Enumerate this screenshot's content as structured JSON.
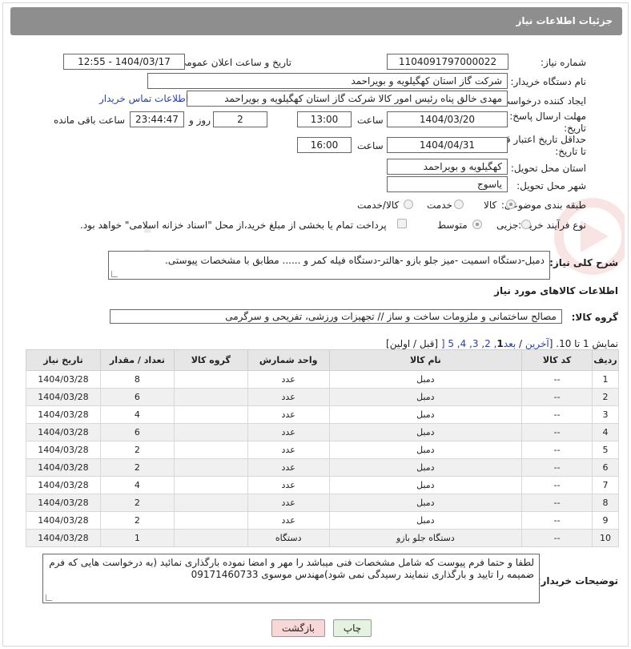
{
  "header": {
    "title": "جزئیات اطلاعات نیاز"
  },
  "form": {
    "need_number_label": "شماره نیاز:",
    "need_number": "1104091797000022",
    "announce_label": "تاریخ و ساعت اعلان عمومی:",
    "announce_value": "1404/03/17 - 12:55",
    "buyer_org_label": "نام دستگاه خریدار:",
    "buyer_org": "شرکت گاز استان کهگیلویه و بویراحمد",
    "creator_label": "ایجاد کننده درخواست:",
    "creator": "مهدی خالق پناه رئیس امور کالا شرکت گاز استان کهگیلویه و بویراحمد",
    "contact_link": "اطلاعات تماس خریدار",
    "reply_deadline_label": "مهلت ارسال پاسخ: تا تاریخ:",
    "reply_date": "1404/03/20",
    "time_label": "ساعت",
    "reply_time": "13:00",
    "days_value": "2",
    "days_label": "روز و",
    "remaining_time": "23:44:47",
    "remaining_label": "ساعت باقی مانده",
    "price_deadline_label": "حداقل تاریخ اعتبار قیمت: تا تاریخ:",
    "price_date": "1404/04/31",
    "price_time": "16:00",
    "province_label": "استان محل تحویل:",
    "province": "کهگیلویه و بویراحمد",
    "city_label": "شهر محل تحویل:",
    "city": "یاسوج",
    "category_label": "طبقه بندی موضوعی:",
    "category_options": [
      "کالا",
      "خدمت",
      "کالا/خدمت"
    ],
    "process_label": "نوع فرآیند خرید :",
    "process_options": [
      "جزیی",
      "متوسط"
    ],
    "payment_note": "پرداخت تمام یا بخشی از مبلغ خرید،از محل \"اسناد خزانه اسلامی\" خواهد بود."
  },
  "description": {
    "label": "شرح کلی نیاز:",
    "text": "دمبل-دستگاه اسمیت -میز جلو بازو -هالتر-دستگاه فیله کمر و ...... مطابق با مشخصات پیوستی."
  },
  "goods": {
    "section_title": "اطلاعات کالاهای مورد نیاز",
    "group_label": "گروه کالا:",
    "group_value": "مصالح ساختمانی و ملزومات ساخت و ساز // تجهیزات ورزشی، تفریحی و سرگرمی"
  },
  "pagination": {
    "prefix": "نمایش 1 تا 10. [",
    "last": "آخرین",
    "slash1": " / ",
    "next": "بعد",
    "pages": "] 5 ,4 ,3 ,2 ,",
    "current": "1",
    "suffix": " [قبل / اولین]"
  },
  "table": {
    "headers": [
      "ردیف",
      "کد کالا",
      "نام کالا",
      "واحد شمارش",
      "گروه کالا",
      "تعداد / مقدار",
      "تاریخ نیاز"
    ],
    "rows": [
      [
        "1",
        "--",
        "دمبل",
        "عدد",
        "",
        "8",
        "1404/03/28"
      ],
      [
        "2",
        "--",
        "دمبل",
        "عدد",
        "",
        "6",
        "1404/03/28"
      ],
      [
        "3",
        "--",
        "دمبل",
        "عدد",
        "",
        "4",
        "1404/03/28"
      ],
      [
        "4",
        "--",
        "دمبل",
        "عدد",
        "",
        "6",
        "1404/03/28"
      ],
      [
        "5",
        "--",
        "دمبل",
        "عدد",
        "",
        "2",
        "1404/03/28"
      ],
      [
        "6",
        "--",
        "دمبل",
        "عدد",
        "",
        "2",
        "1404/03/28"
      ],
      [
        "7",
        "--",
        "دمبل",
        "عدد",
        "",
        "4",
        "1404/03/28"
      ],
      [
        "8",
        "--",
        "دمبل",
        "عدد",
        "",
        "2",
        "1404/03/28"
      ],
      [
        "9",
        "--",
        "دمبل",
        "عدد",
        "",
        "2",
        "1404/03/28"
      ],
      [
        "10",
        "--",
        "دستگاه جلو بازو",
        "دستگاه",
        "",
        "1",
        "1404/03/28"
      ]
    ]
  },
  "notes": {
    "label": "توضیحات خریدار:",
    "text": "لطفا و حتما فرم پیوست که شامل مشخصات فنی میباشد را مهر و امضا نموده بارگذاری نمائید (به درخواست هایی که فرم ضمیمه را تایید و بارگذاری ننمایند رسیدگی نمی شود)مهندس موسوی 09171460733"
  },
  "buttons": {
    "print": "چاپ",
    "back": "بازگشت"
  },
  "colors": {
    "titlebar": "#8e8e8e",
    "link": "#2a3fae",
    "back_button": "#f7d7d7",
    "print_button": "#e3f3df"
  }
}
